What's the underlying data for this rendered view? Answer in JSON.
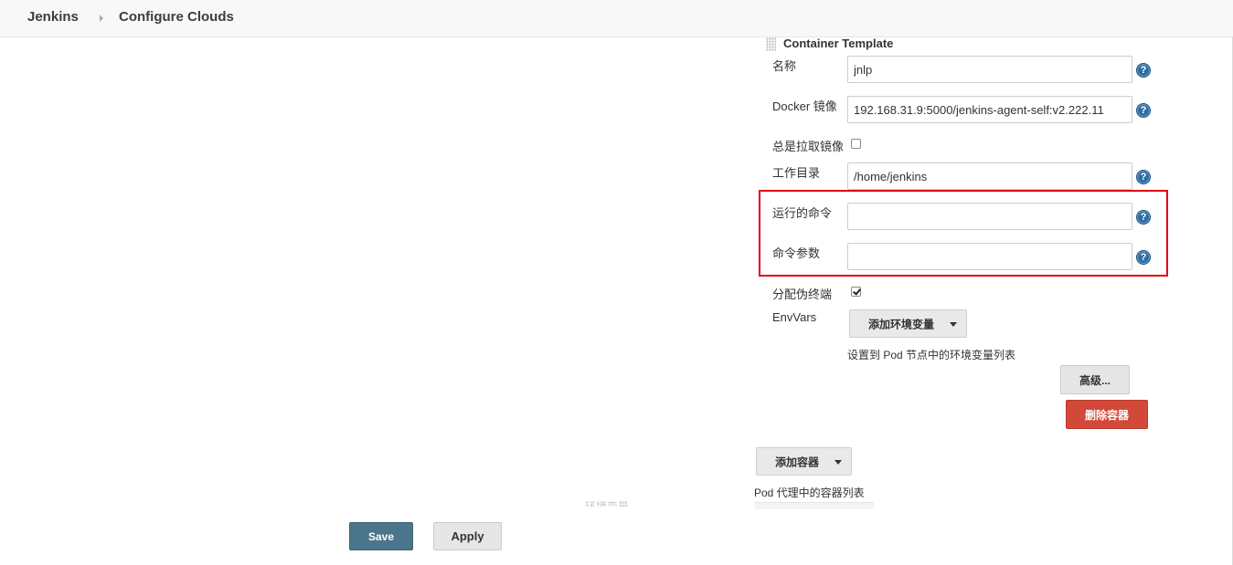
{
  "breadcrumb": {
    "home": "Jenkins",
    "page": "Configure Clouds"
  },
  "container_template": {
    "title": "Container Template",
    "name_label": "名称",
    "name_value": "jnlp",
    "image_label": "Docker 镜像",
    "image_value": "192.168.31.9:5000/jenkins-agent-self:v2.222.11",
    "always_pull_label": "总是拉取镜像",
    "always_pull_checked": false,
    "workdir_label": "工作目录",
    "workdir_value": "/home/jenkins",
    "command_label": "运行的命令",
    "command_value": "",
    "args_label": "命令参数",
    "args_value": "",
    "tty_label": "分配伪终端",
    "tty_checked": true,
    "envvars_label": "EnvVars",
    "add_env_button": "添加环境变量",
    "env_hint": "设置到 Pod 节点中的环境变量列表",
    "advanced_button": "高级...",
    "delete_button": "删除容器",
    "help_glyph": "?"
  },
  "containers": {
    "add_container_button": "添加容器",
    "hint": "Pod 代理中的容器列表"
  },
  "footer": {
    "save_label": "Save",
    "apply_label": "Apply"
  },
  "colors": {
    "highlight_box": "#e00010",
    "save_button": "#4b758b",
    "delete_button": "#d24939"
  }
}
